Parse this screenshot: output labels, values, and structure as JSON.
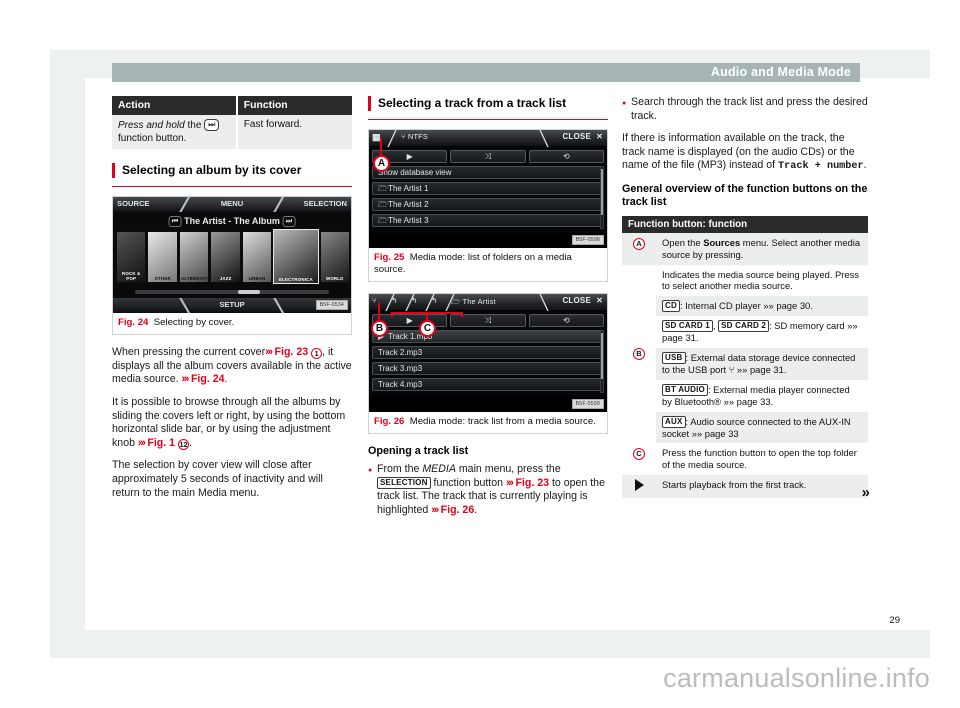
{
  "header": {
    "title": "Audio and Media Mode"
  },
  "page_number": "29",
  "footer_brand": "carmanualsonline.info",
  "continue_symbol": "»",
  "col1": {
    "table": {
      "headers": [
        "Action",
        "Function"
      ],
      "rows": [
        {
          "action_prefix": "Press and hold",
          "action_mid": " the ",
          "action_chip": "⏭",
          "action_suffix": " function button.",
          "function": "Fast forward."
        }
      ]
    },
    "section_title": "Selecting an album by its cover",
    "figure": {
      "screen": {
        "top_left": "SOURCE",
        "top_center": "MENU",
        "top_right": "SELECTION",
        "now_playing": "The Artist - The Album",
        "prev_icon": "⏮",
        "next_icon": "⏭",
        "bottom_center": "SETUP",
        "covers": [
          "ROCK & POP",
          "OTHER",
          "ALTERNATIVE",
          "JAZZ",
          "URBAN",
          "ELECTRONICA",
          "WORLD"
        ],
        "code": "B5F-0534"
      },
      "caption_label": "Fig. 24",
      "caption_text": "Selecting by cover."
    },
    "paragraphs": [
      "When pressing the current cover »» Fig. 23 (1), it displays all the album covers available in the active media source. »» Fig. 24.",
      "It is possible to browse through all the albums by sliding the covers left or right, by using the bottom horizontal slide bar, or by using the adjustment knob »» Fig. 1 (12).",
      "The selection by cover view will close after approximately 5 seconds of inactivity and will return to the main Media menu."
    ]
  },
  "col2": {
    "section_title": "Selecting a track from a track list",
    "figure25": {
      "screen": {
        "source_icon": "cube-icon",
        "usb_icon": "⑂",
        "path_label": "NTFS",
        "close_label": "CLOSE",
        "close_x": "✕",
        "buttons": [
          "▶",
          "⤨",
          "⟲"
        ],
        "rows": [
          "Show database view",
          "The Artist 1",
          "The Artist 2",
          "The Artist 3"
        ],
        "code": "B5F-0598",
        "callout_a": "A"
      },
      "caption_label": "Fig. 25",
      "caption_text": "Media mode: list of folders on a media source."
    },
    "figure26": {
      "screen": {
        "usb_icon": "⑂",
        "back_icons": [
          "↰",
          "↰",
          "↰"
        ],
        "path_label": "The Artist",
        "close_label": "CLOSE",
        "close_x": "✕",
        "buttons": [
          "▶",
          "⤨",
          "⟲"
        ],
        "rows": [
          "Track 1.mp3",
          "Track 2.mp3",
          "Track 3.mp3",
          "Track 4.mp3"
        ],
        "code": "B5F-0599",
        "callout_b": "B",
        "callout_c": "C"
      },
      "caption_label": "Fig. 26",
      "caption_text": "Media mode: track list from a media source."
    },
    "subheading": "Opening a track list",
    "bullet": {
      "pre": "From the ",
      "menu": "MEDIA",
      "mid": " main menu, press the ",
      "chip": "SELECTION",
      "mid2": " function button ",
      "ref": "»» Fig. 23",
      "post": " to open the track list. The track that is currently playing is highlighted ",
      "ref2": "»» Fig. 26",
      "end": "."
    }
  },
  "col3": {
    "bullet": "Search through the track list and press the desired track.",
    "paragraph_pre": "If there is information available on the track, the track name is displayed (on the audio CDs) or the name of the file (MP3) instead of ",
    "paragraph_mono": "Track + number",
    "paragraph_post": ".",
    "subheading": "General overview of the function buttons on the track list",
    "table": {
      "header": "Function button: function",
      "rows": [
        {
          "key": "A",
          "key_type": "circle",
          "cells": [
            {
              "shade": "alt",
              "pre": "Open the ",
              "bold": "Sources",
              "post": " menu. Select another media source by pressing."
            }
          ]
        },
        {
          "key": "B",
          "key_type": "circle",
          "cells": [
            {
              "shade": "wht",
              "text": "Indicates the media source being played. Press to select another media source."
            },
            {
              "shade": "alt",
              "chip": "CD",
              "text": ": Internal CD player »» page 30."
            },
            {
              "shade": "wht",
              "chip": "SD CARD 1",
              "chip2": "SD CARD 2",
              "text": ": SD memory card »» page 31."
            },
            {
              "shade": "alt",
              "chip": "USB",
              "text": ": External data storage device connected to the USB port ⑂ »» page 31."
            },
            {
              "shade": "wht",
              "chip": "BT AUDIO",
              "text": ": External media player connected by Bluetooth® »» page 33."
            },
            {
              "shade": "alt",
              "chip": "AUX",
              "text": ": Audio source connected to the AUX-IN socket »» page 33"
            }
          ]
        },
        {
          "key": "C",
          "key_type": "circle",
          "cells": [
            {
              "shade": "wht",
              "text": "Press the function button to open the top folder of the media source."
            }
          ]
        },
        {
          "key": "▶",
          "key_type": "play",
          "cells": [
            {
              "shade": "alt",
              "text": "Starts playback from the first track."
            }
          ]
        }
      ]
    }
  }
}
